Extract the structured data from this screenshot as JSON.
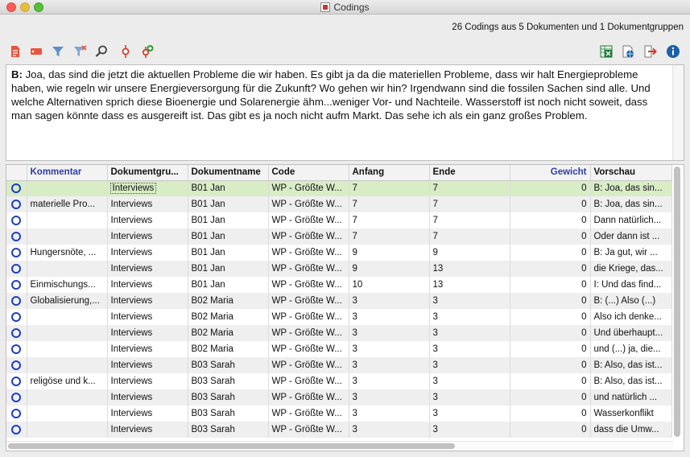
{
  "window": {
    "title": "Codings"
  },
  "summary": "26 Codings aus 5 Dokumenten und 1 Dokumentgruppen",
  "toolbar": {
    "left": [
      {
        "name": "document-icon",
        "color": "#e8533e"
      },
      {
        "name": "tag-icon",
        "color": "#e8533e"
      },
      {
        "name": "filter-icon",
        "color": "#5c8fc8"
      },
      {
        "name": "clear-filter-icon",
        "color": "#5c8fc8"
      },
      {
        "name": "search-icon",
        "color": "#444"
      },
      {
        "name": "code-icon",
        "color": "#d83a2a"
      },
      {
        "name": "add-code-icon",
        "color": "#2a9d3a"
      }
    ],
    "right": [
      {
        "name": "excel-export-icon",
        "color": "#1f7a3b"
      },
      {
        "name": "web-export-icon",
        "color": "#1f5fa8"
      },
      {
        "name": "export-icon",
        "color": "#d83a2a"
      },
      {
        "name": "info-icon",
        "color": "#1f5fa8"
      }
    ]
  },
  "preview": {
    "speaker": "B:",
    "text": " Joa, das sind die jetzt die aktuellen Probleme die wir haben. Es gibt ja da die materiellen Probleme, dass wir halt Energieprobleme haben, wie regeln wir unsere Energieversorgung für die Zukunft? Wo gehen wir hin? Irgendwann sind die fossilen Sachen sind alle. Und welche Alternativen sprich diese Bioenergie und Solarenergie ähm...weniger Vor- und Nachteile. Wasserstoff ist noch nicht soweit, dass man sagen könnte dass es ausgereift ist. Das gibt es ja noch nicht aufm Markt. Das sehe ich als ein ganz großes Problem."
  },
  "table": {
    "columns": [
      "",
      "Kommentar",
      "Dokumentgru...",
      "Dokumentname",
      "Code",
      "Anfang",
      "Ende",
      "Gewicht",
      "Vorschau"
    ],
    "rows": [
      {
        "kommentar": "",
        "gruppe": "Interviews",
        "name": "B01 Jan",
        "code": "WP - Größte W...",
        "anfang": "7",
        "ende": "7",
        "gewicht": "0",
        "vorschau": "B: Joa, das sin..."
      },
      {
        "kommentar": "materielle Pro...",
        "gruppe": "Interviews",
        "name": "B01 Jan",
        "code": "WP - Größte W...",
        "anfang": "7",
        "ende": "7",
        "gewicht": "0",
        "vorschau": "B: Joa, das sin..."
      },
      {
        "kommentar": "",
        "gruppe": "Interviews",
        "name": "B01 Jan",
        "code": "WP - Größte W...",
        "anfang": "7",
        "ende": "7",
        "gewicht": "0",
        "vorschau": "Dann natürlich..."
      },
      {
        "kommentar": "",
        "gruppe": "Interviews",
        "name": "B01 Jan",
        "code": "WP - Größte W...",
        "anfang": "7",
        "ende": "7",
        "gewicht": "0",
        "vorschau": "Oder dann ist ..."
      },
      {
        "kommentar": "Hungersnöte, ...",
        "gruppe": "Interviews",
        "name": "B01 Jan",
        "code": "WP - Größte W...",
        "anfang": "9",
        "ende": "9",
        "gewicht": "0",
        "vorschau": "B: Ja gut, wir ..."
      },
      {
        "kommentar": "",
        "gruppe": "Interviews",
        "name": "B01 Jan",
        "code": "WP - Größte W...",
        "anfang": "9",
        "ende": "13",
        "gewicht": "0",
        "vorschau": "die Kriege, das..."
      },
      {
        "kommentar": "Einmischungs...",
        "gruppe": "Interviews",
        "name": "B01 Jan",
        "code": "WP - Größte W...",
        "anfang": "10",
        "ende": "13",
        "gewicht": "0",
        "vorschau": "I: Und das find..."
      },
      {
        "kommentar": "Globalisierung,...",
        "gruppe": "Interviews",
        "name": "B02 Maria",
        "code": "WP - Größte W...",
        "anfang": "3",
        "ende": "3",
        "gewicht": "0",
        "vorschau": "B: (...) Also (...)"
      },
      {
        "kommentar": "",
        "gruppe": "Interviews",
        "name": "B02 Maria",
        "code": "WP - Größte W...",
        "anfang": "3",
        "ende": "3",
        "gewicht": "0",
        "vorschau": "Also ich denke..."
      },
      {
        "kommentar": "",
        "gruppe": "Interviews",
        "name": "B02 Maria",
        "code": "WP - Größte W...",
        "anfang": "3",
        "ende": "3",
        "gewicht": "0",
        "vorschau": "Und überhaupt..."
      },
      {
        "kommentar": "",
        "gruppe": "Interviews",
        "name": "B02 Maria",
        "code": "WP - Größte W...",
        "anfang": "3",
        "ende": "3",
        "gewicht": "0",
        "vorschau": " und (...) ja, die..."
      },
      {
        "kommentar": "",
        "gruppe": "Interviews",
        "name": "B03 Sarah",
        "code": "WP - Größte W...",
        "anfang": "3",
        "ende": "3",
        "gewicht": "0",
        "vorschau": "B: Also, das ist..."
      },
      {
        "kommentar": "religöse und k...",
        "gruppe": "Interviews",
        "name": "B03 Sarah",
        "code": "WP - Größte W...",
        "anfang": "3",
        "ende": "3",
        "gewicht": "0",
        "vorschau": "B: Also, das ist..."
      },
      {
        "kommentar": "",
        "gruppe": "Interviews",
        "name": "B03 Sarah",
        "code": "WP - Größte W...",
        "anfang": "3",
        "ende": "3",
        "gewicht": "0",
        "vorschau": "und natürlich ..."
      },
      {
        "kommentar": "",
        "gruppe": "Interviews",
        "name": "B03 Sarah",
        "code": "WP - Größte W...",
        "anfang": "3",
        "ende": "3",
        "gewicht": "0",
        "vorschau": "Wasserkonflikt"
      },
      {
        "kommentar": "",
        "gruppe": "Interviews",
        "name": "B03 Sarah",
        "code": "WP - Größte W...",
        "anfang": "3",
        "ende": "3",
        "gewicht": "0",
        "vorschau": "dass die Umw..."
      }
    ]
  }
}
